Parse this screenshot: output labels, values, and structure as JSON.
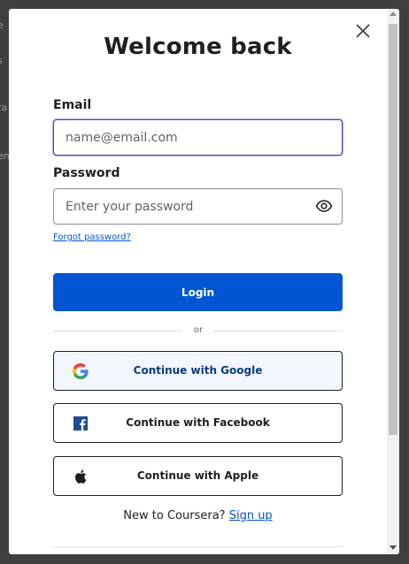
{
  "background": {
    "fragments": [
      "e",
      "s",
      "ra",
      "en"
    ]
  },
  "modal": {
    "title": "Welcome back",
    "close_icon": "close-icon"
  },
  "form": {
    "email_label": "Email",
    "email_placeholder": "name@email.com",
    "email_value": "",
    "password_label": "Password",
    "password_placeholder": "Enter your password",
    "password_value": "",
    "password_toggle_icon": "eye-icon",
    "forgot_password": "Forgot password?",
    "login_label": "Login"
  },
  "divider": {
    "text": "or"
  },
  "social": [
    {
      "label": "Continue with Google",
      "icon": "google-icon"
    },
    {
      "label": "Continue with Facebook",
      "icon": "facebook-icon"
    },
    {
      "label": "Continue with Apple",
      "icon": "apple-icon"
    }
  ],
  "signup": {
    "prompt": "New to Coursera?",
    "link": "Sign up"
  },
  "colors": {
    "primary": "#0056d2",
    "focus": "#5b3ac7",
    "google_bg": "#f2f6fd",
    "facebook": "#1877f2"
  }
}
